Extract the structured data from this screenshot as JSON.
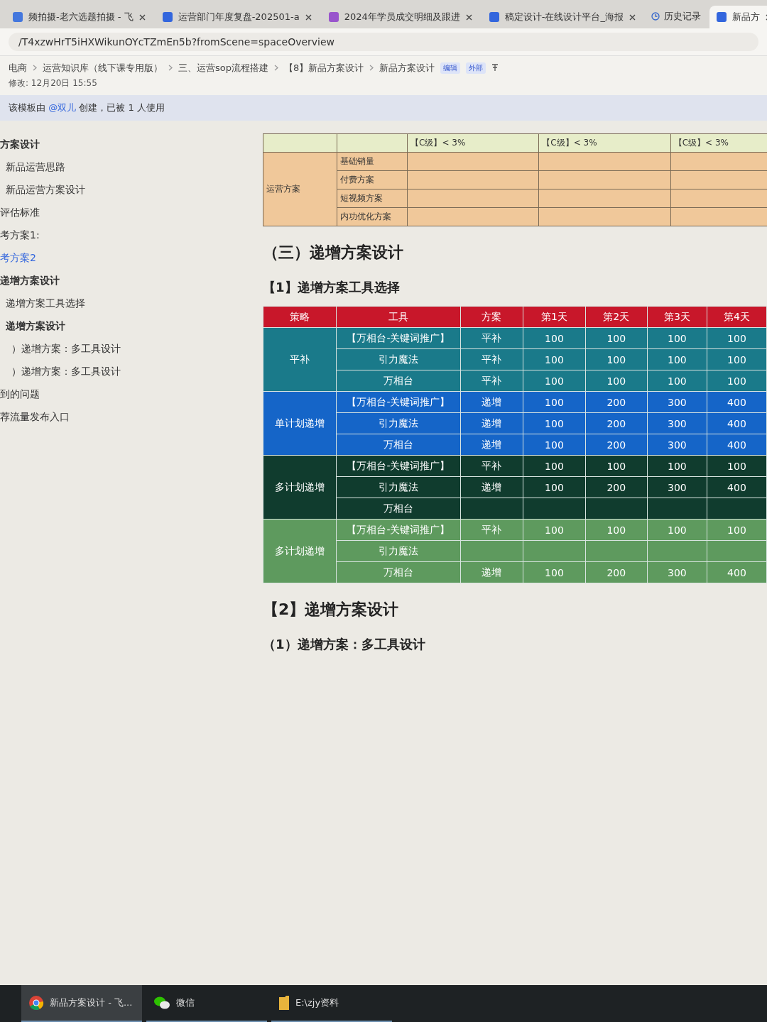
{
  "browser_tabs": [
    {
      "title": "频拍摄-老六选题拍摄 - 飞",
      "selected": false
    },
    {
      "title": "运营部门年度复盘-202501-a",
      "selected": false
    },
    {
      "title": "2024年学员成交明细及跟进",
      "selected": false
    },
    {
      "title": "稿定设计-在线设计平台_海报",
      "selected": false
    },
    {
      "title": "新品方",
      "selected": true
    }
  ],
  "bookmark": "历史记录",
  "url": "/T4xzwHrT5iHXWikunOYcTZmEn5b?fromScene=spaceOverview",
  "breadcrumbs": [
    "电商",
    "运营知识库（线下课专用版）",
    "三、运营sop流程搭建",
    "【8】新品方案设计",
    "新品方案设计"
  ],
  "doc_tags": [
    "编辑",
    "外部"
  ],
  "modified": "修改: 12月20日 15:55",
  "notice": {
    "before": "该模板由 ",
    "mention": "@双儿",
    "after": " 创建，已被 1 人使用"
  },
  "outline": [
    {
      "label": "方案设计",
      "selected": false,
      "children": [
        {
          "label": "新品运营思路",
          "selected": false
        },
        {
          "label": "新品运营方案设计",
          "selected": false
        }
      ]
    },
    {
      "label": "评估标准",
      "selected": false
    },
    {
      "label": "考方案1:",
      "selected": false
    },
    {
      "label": "考方案2",
      "selected": true
    },
    {
      "label": "递增方案设计",
      "selected": false,
      "children": [
        {
          "label": "递增方案工具选择",
          "selected": false
        },
        {
          "label": "递增方案设计",
          "selected": false,
          "children": [
            {
              "label": "）递增方案：多工具设计",
              "selected": false
            },
            {
              "label": "）递增方案：多工具设计",
              "selected": false
            }
          ]
        }
      ]
    },
    {
      "label": "到的问题",
      "selected": false
    },
    {
      "label": "荐流量发布入口",
      "selected": false
    }
  ],
  "plan_table": {
    "header": [
      "【C级】< 3%",
      "【C级】< 3%",
      "【C级】< 3%"
    ],
    "group": "运营方案",
    "rows": [
      "基础销量",
      "付费方案",
      "短视频方案",
      "内功优化方案"
    ]
  },
  "heading_1": "（三）递增方案设计",
  "heading_2": "【1】递增方案工具选择",
  "tool_table": {
    "columns": [
      "策略",
      "工具",
      "方案",
      "第1天",
      "第2天",
      "第3天",
      "第4天"
    ],
    "groups": [
      {
        "strategy": "平补",
        "color": "#1a7a8a",
        "rows": [
          {
            "tool": "【万相台-关键词推广】",
            "plan": "平补",
            "days": [
              "100",
              "100",
              "100",
              "100"
            ]
          },
          {
            "tool": "引力魔法",
            "plan": "平补",
            "days": [
              "100",
              "100",
              "100",
              "100"
            ]
          },
          {
            "tool": "万相台",
            "plan": "平补",
            "days": [
              "100",
              "100",
              "100",
              "100"
            ]
          }
        ]
      },
      {
        "strategy": "单计划递增",
        "color": "#1565c8",
        "rows": [
          {
            "tool": "【万相台-关键词推广】",
            "plan": "递增",
            "days": [
              "100",
              "200",
              "300",
              "400"
            ]
          },
          {
            "tool": "引力魔法",
            "plan": "递增",
            "days": [
              "100",
              "200",
              "300",
              "400"
            ]
          },
          {
            "tool": "万相台",
            "plan": "递增",
            "days": [
              "100",
              "200",
              "300",
              "400"
            ]
          }
        ]
      },
      {
        "strategy": "多计划递增",
        "color": "#103c2e",
        "rows": [
          {
            "tool": "【万相台-关键词推广】",
            "plan": "平补",
            "days": [
              "100",
              "100",
              "100",
              "100"
            ]
          },
          {
            "tool": "引力魔法",
            "plan": "递增",
            "days": [
              "100",
              "200",
              "300",
              "400"
            ]
          },
          {
            "tool": "万相台"
          }
        ]
      },
      {
        "strategy": "多计划递增",
        "color": "#5e9a5e",
        "rows": [
          {
            "tool": "【万相台-关键词推广】",
            "plan": "平补",
            "days": [
              "100",
              "100",
              "100",
              "100"
            ]
          },
          {
            "tool": "引力魔法"
          },
          {
            "tool": "万相台",
            "plan": "递增",
            "days": [
              "100",
              "200",
              "300",
              "400"
            ]
          }
        ]
      }
    ]
  },
  "heading_3": "【2】递增方案设计",
  "heading_4": "（1）递增方案：多工具设计",
  "taskbar": [
    {
      "kind": "chrome",
      "label": "新品方案设计 - 飞...",
      "selected": true
    },
    {
      "kind": "wechat",
      "label": "微信",
      "selected": false
    },
    {
      "kind": "folder",
      "label": "E:\\zjy资料",
      "selected": false
    }
  ]
}
